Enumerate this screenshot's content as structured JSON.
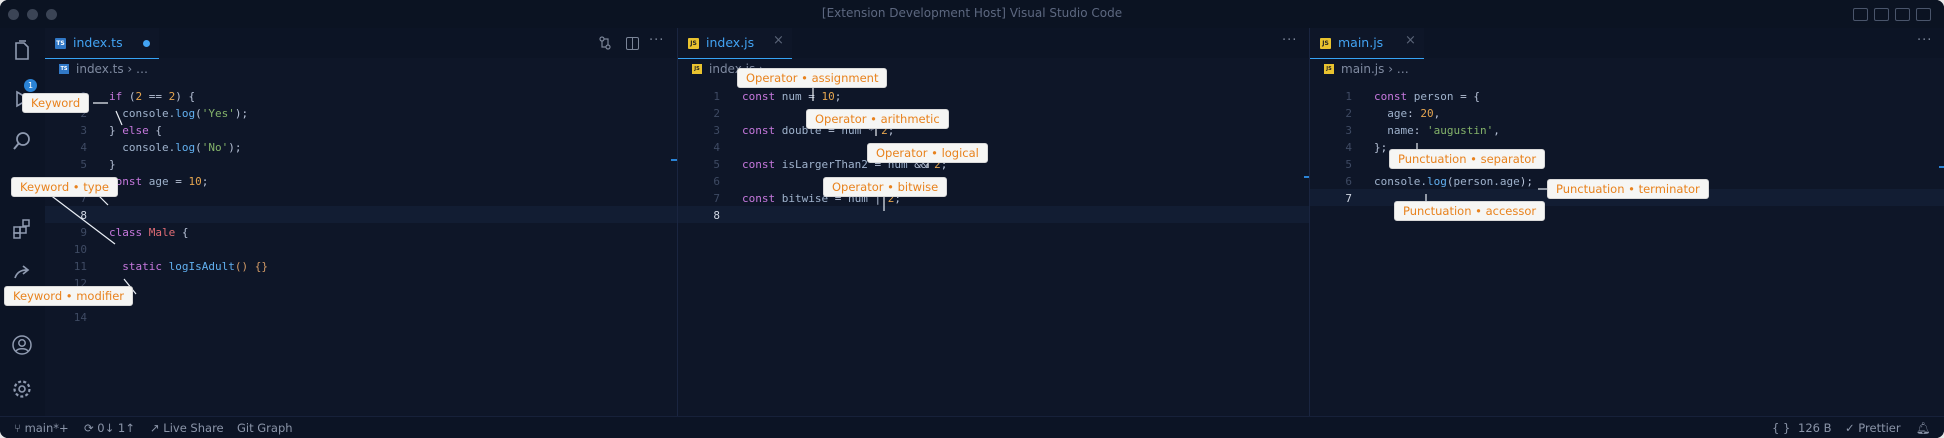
{
  "window": {
    "title": "[Extension Development Host] Visual Studio Code"
  },
  "activity_badge": "1",
  "panes": [
    {
      "tab": {
        "name": "index.ts",
        "icon": "TS",
        "modified": true
      },
      "breadcrumb": "index.ts  ›  …",
      "current_line": 8,
      "lines": [
        {
          "n": "1",
          "tokens": [
            [
              "kw",
              "if"
            ],
            [
              "op",
              " ("
            ],
            [
              "num",
              "2"
            ],
            [
              "op",
              " == "
            ],
            [
              "num",
              "2"
            ],
            [
              "op",
              ") {"
            ]
          ]
        },
        {
          "n": "2",
          "tokens": [
            [
              "var",
              "  console."
            ],
            [
              "fn",
              "log"
            ],
            [
              "op",
              "("
            ],
            [
              "str",
              "'Yes'"
            ],
            [
              "op",
              ");"
            ]
          ]
        },
        {
          "n": "3",
          "tokens": [
            [
              "op",
              "} "
            ],
            [
              "kw",
              "else"
            ],
            [
              "op",
              " {"
            ]
          ]
        },
        {
          "n": "4",
          "tokens": [
            [
              "var",
              "  console."
            ],
            [
              "fn",
              "log"
            ],
            [
              "op",
              "("
            ],
            [
              "str",
              "'No'"
            ],
            [
              "op",
              ");"
            ]
          ]
        },
        {
          "n": "5",
          "tokens": [
            [
              "op",
              "}"
            ]
          ]
        },
        {
          "n": "6",
          "tokens": [
            [
              "kw",
              "const"
            ],
            [
              "var",
              " age "
            ],
            [
              "op",
              "= "
            ],
            [
              "num",
              "10"
            ],
            [
              "op",
              ";"
            ]
          ]
        },
        {
          "n": "7",
          "tokens": []
        },
        {
          "n": "8",
          "tokens": []
        },
        {
          "n": "9",
          "tokens": [
            [
              "kw",
              "class"
            ],
            [
              "cls",
              " Male "
            ],
            [
              "op",
              "{"
            ]
          ]
        },
        {
          "n": "10",
          "tokens": []
        },
        {
          "n": "11",
          "tokens": [
            [
              "kw",
              "  static"
            ],
            [
              "fn",
              " logIsAdult"
            ],
            [
              "pn",
              "() {}"
            ]
          ]
        },
        {
          "n": "12",
          "tokens": []
        },
        {
          "n": "13",
          "tokens": [
            [
              "op",
              "}"
            ]
          ]
        },
        {
          "n": "14",
          "tokens": []
        }
      ]
    },
    {
      "tab": {
        "name": "index.js",
        "icon": "JS",
        "modified": false
      },
      "breadcrumb": "index.js  ›  …",
      "current_line": 8,
      "lines": [
        {
          "n": "1",
          "tokens": [
            [
              "kw",
              "const"
            ],
            [
              "var",
              " num "
            ],
            [
              "op",
              "= "
            ],
            [
              "num",
              "10"
            ],
            [
              "op",
              ";"
            ]
          ]
        },
        {
          "n": "2",
          "tokens": []
        },
        {
          "n": "3",
          "tokens": [
            [
              "kw",
              "const"
            ],
            [
              "var",
              " double "
            ],
            [
              "op",
              "= "
            ],
            [
              "var",
              "num "
            ],
            [
              "op",
              "* "
            ],
            [
              "num",
              "2"
            ],
            [
              "op",
              ";"
            ]
          ]
        },
        {
          "n": "4",
          "tokens": []
        },
        {
          "n": "5",
          "tokens": [
            [
              "kw",
              "const"
            ],
            [
              "var",
              " isLargerThan2 "
            ],
            [
              "op",
              "= "
            ],
            [
              "var",
              "num "
            ],
            [
              "op",
              "&& "
            ],
            [
              "num",
              "2"
            ],
            [
              "op",
              ";"
            ]
          ]
        },
        {
          "n": "6",
          "tokens": []
        },
        {
          "n": "7",
          "tokens": [
            [
              "kw",
              "const"
            ],
            [
              "var",
              " bitwise "
            ],
            [
              "op",
              "= "
            ],
            [
              "var",
              "num "
            ],
            [
              "op",
              "| "
            ],
            [
              "num",
              "2"
            ],
            [
              "op",
              ";"
            ]
          ]
        },
        {
          "n": "8",
          "tokens": []
        }
      ]
    },
    {
      "tab": {
        "name": "main.js",
        "icon": "JS",
        "modified": false
      },
      "breadcrumb": "main.js  ›  …",
      "current_line": 7,
      "lines": [
        {
          "n": "1",
          "tokens": [
            [
              "kw",
              "const"
            ],
            [
              "var",
              " person "
            ],
            [
              "op",
              "= {"
            ]
          ]
        },
        {
          "n": "2",
          "tokens": [
            [
              "var",
              "  age"
            ],
            [
              "op",
              ": "
            ],
            [
              "num",
              "20"
            ],
            [
              "op",
              ","
            ]
          ]
        },
        {
          "n": "3",
          "tokens": [
            [
              "var",
              "  name"
            ],
            [
              "op",
              ": "
            ],
            [
              "str",
              "'augustin'"
            ],
            [
              "op",
              ","
            ]
          ]
        },
        {
          "n": "4",
          "tokens": [
            [
              "op",
              "};"
            ]
          ]
        },
        {
          "n": "5",
          "tokens": []
        },
        {
          "n": "6",
          "tokens": [
            [
              "var",
              "console."
            ],
            [
              "fn",
              "log"
            ],
            [
              "op",
              "("
            ],
            [
              "var",
              "person.age"
            ],
            [
              "op",
              ");"
            ]
          ]
        },
        {
          "n": "7",
          "tokens": []
        }
      ]
    }
  ],
  "annotations": [
    {
      "id": "kw",
      "text": "Keyword"
    },
    {
      "id": "kwtype",
      "text": "Keyword • type"
    },
    {
      "id": "kwmod",
      "text": "Keyword • modifier"
    },
    {
      "id": "opassign",
      "text": "Operator • assignment"
    },
    {
      "id": "oparith",
      "text": "Operator • arithmetic"
    },
    {
      "id": "oplogic",
      "text": "Operator • logical"
    },
    {
      "id": "opbit",
      "text": "Operator • bitwise"
    },
    {
      "id": "punsep",
      "text": "Punctuation • separator"
    },
    {
      "id": "punterm",
      "text": "Punctuation • terminator"
    },
    {
      "id": "punacc",
      "text": "Punctuation • accessor"
    }
  ],
  "status": {
    "branch": "main*+",
    "sync": "0↓ 1↑",
    "live_share": "Live Share",
    "git_graph": "Git Graph",
    "braces": "{ }",
    "size": "126 B",
    "prettier": "✓ Prettier"
  }
}
